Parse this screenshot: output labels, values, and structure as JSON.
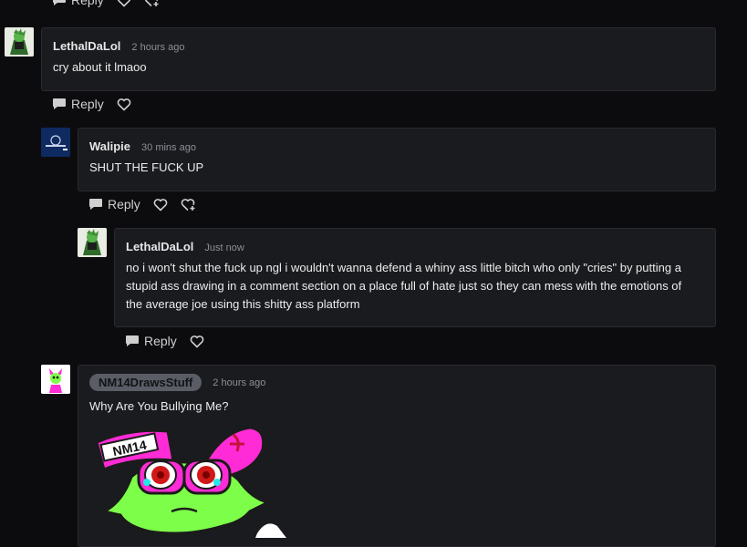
{
  "comments": [
    {
      "author": "LethalDaLol",
      "time": "2 hours ago",
      "text": "cry about it lmaoo",
      "reply_label": "Reply"
    },
    {
      "author": "Walipie",
      "time": "30 mins ago",
      "text": "SHUT THE FUCK UP",
      "reply_label": "Reply"
    },
    {
      "author": "LethalDaLol",
      "time": "Just now",
      "text": "no i won't shut the fuck up ngl i wouldn't wanna defend a whiny ass little bitch who only \"cries\" by putting a stupid ass drawing in a comment section on a place full of hate just so they can mess with the emotions of the average joe using this shitty ass platform",
      "reply_label": "Reply"
    },
    {
      "author": "NM14DrawsStuff",
      "time": "2 hours ago",
      "text": "Why Are You Bullying Me?",
      "drawing_label": "NM14"
    }
  ],
  "top_actions": {
    "reply_label": "Reply"
  },
  "colors": {
    "background": "#0c0c0f",
    "card": "#1a1b1f",
    "border": "#2a2b30",
    "muted": "#8d8f96"
  }
}
